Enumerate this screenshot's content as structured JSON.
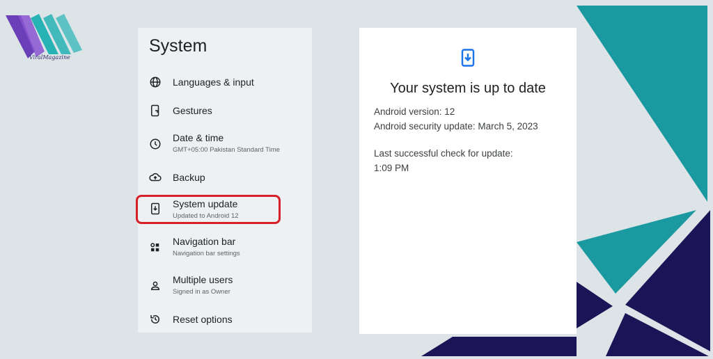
{
  "brand": {
    "logo_text": "ViralMagazine"
  },
  "settings": {
    "title": "System",
    "items": [
      {
        "label": "Languages & input",
        "subtitle": "",
        "icon": "globe-icon"
      },
      {
        "label": "Gestures",
        "subtitle": "",
        "icon": "phone-gesture-icon"
      },
      {
        "label": "Date & time",
        "subtitle": "GMT+05:00 Pakistan Standard Time",
        "icon": "clock-icon"
      },
      {
        "label": "Backup",
        "subtitle": "",
        "icon": "cloud-upload-icon"
      },
      {
        "label": "System update",
        "subtitle": "Updated to Android 12",
        "icon": "system-update-icon"
      },
      {
        "label": "Navigation bar",
        "subtitle": "Navigation bar settings",
        "icon": "navigation-bar-icon"
      },
      {
        "label": "Multiple users",
        "subtitle": "Signed in as Owner",
        "icon": "person-icon"
      },
      {
        "label": "Reset options",
        "subtitle": "",
        "icon": "history-icon"
      }
    ]
  },
  "detail": {
    "title": "Your system is up to date",
    "android_version": "Android version: 12",
    "security_update": "Android security update: March 5, 2023",
    "last_check_label": "Last successful check for update:",
    "last_check_time": "1:09 PM"
  },
  "colors": {
    "teal": "#1a9aa0",
    "navy": "#1b1456",
    "highlight": "#d61f26",
    "accent_blue": "#1a73e8"
  }
}
